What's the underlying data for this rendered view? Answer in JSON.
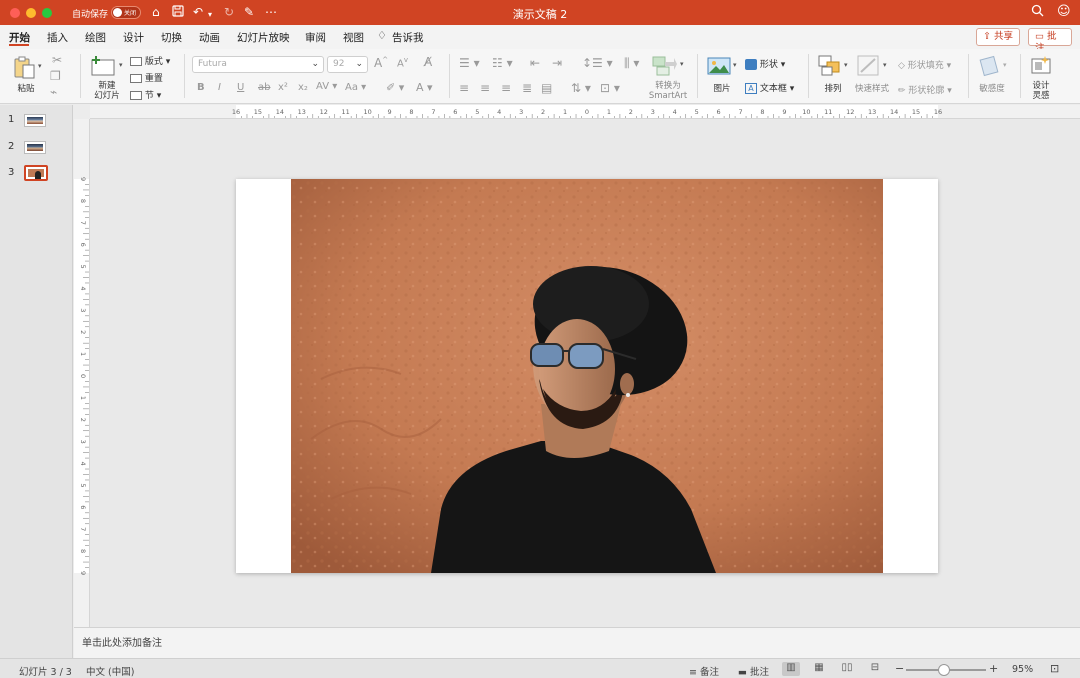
{
  "window": {
    "title": "演示文稿 2",
    "autosave_label": "自动保存",
    "autosave_state": "关闭"
  },
  "colors": {
    "accent": "#d04423",
    "titlebar": "#d04423"
  },
  "tabs": [
    "开始",
    "插入",
    "绘图",
    "设计",
    "切换",
    "动画",
    "幻灯片放映",
    "审阅",
    "视图",
    "告诉我"
  ],
  "active_tab": "开始",
  "header_buttons": {
    "share": "共享",
    "comment": "批注"
  },
  "ribbon": {
    "paste": "粘贴",
    "new_slide": "新建\n幻灯片",
    "new_slide_l1": "新建",
    "new_slide_l2": "幻灯片",
    "layout": "版式",
    "reset": "重置",
    "section": "节",
    "font_name": "Futura",
    "font_size": "92",
    "convert_smartart_l1": "转换为",
    "convert_smartart_l2": "SmartArt",
    "picture": "图片",
    "shape": "形状",
    "textbox": "文本框",
    "arrange": "排列",
    "quick_styles": "快速样式",
    "shape_fill": "形状填充",
    "shape_outline": "形状轮廓",
    "sensitivity": "敏感度",
    "designer_l1": "设计",
    "designer_l2": "灵感"
  },
  "slides": [
    {
      "number": "1"
    },
    {
      "number": "2"
    },
    {
      "number": "3",
      "active": true
    }
  ],
  "ruler": {
    "h_ticks": [
      "16",
      "15",
      "14",
      "13",
      "12",
      "11",
      "10",
      "9",
      "8",
      "7",
      "6",
      "5",
      "4",
      "3",
      "2",
      "1",
      "0",
      "1",
      "2",
      "3",
      "4",
      "5",
      "6",
      "7",
      "8",
      "9",
      "10",
      "11",
      "12",
      "13",
      "14",
      "15",
      "16"
    ],
    "v_ticks": [
      "9",
      "8",
      "7",
      "6",
      "5",
      "4",
      "3",
      "2",
      "1",
      "0",
      "1",
      "2",
      "3",
      "4",
      "5",
      "6",
      "7",
      "8",
      "9"
    ]
  },
  "notes": {
    "placeholder": "单击此处添加备注"
  },
  "status": {
    "slide_counter": "幻灯片 3 / 3",
    "language": "中文 (中国)",
    "notes_btn": "备注",
    "comments_btn": "批注",
    "zoom": "95%"
  }
}
